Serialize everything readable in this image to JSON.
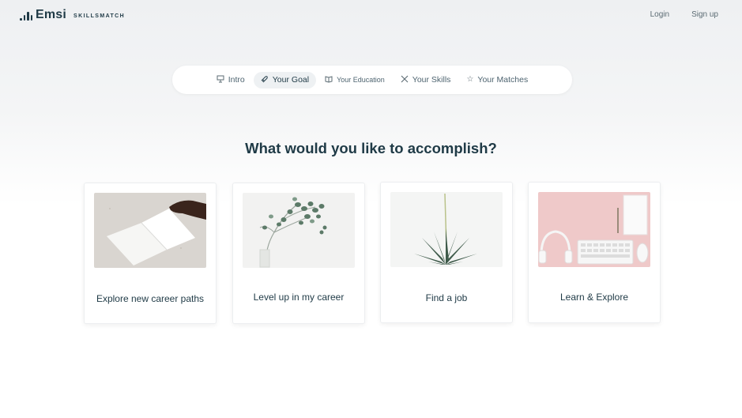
{
  "brand": {
    "name": "Emsi",
    "product": "SKILLSMATCH"
  },
  "nav": {
    "login": "Login",
    "signup": "Sign up"
  },
  "steps": [
    {
      "label": "Intro",
      "icon": "presentation-board-icon"
    },
    {
      "label": "Your Goal",
      "icon": "rocket-icon",
      "active": true
    },
    {
      "label": "Your Education",
      "icon": "book-icon"
    },
    {
      "label": "Your Skills",
      "icon": "tools-icon"
    },
    {
      "label": "Your Matches",
      "icon": "star-icon"
    }
  ],
  "heading": "What would you like to accomplish?",
  "cards": [
    {
      "label": "Explore new career paths",
      "image": "open-notebook"
    },
    {
      "label": "Level up in my career",
      "image": "eucalyptus-branch"
    },
    {
      "label": "Find a job",
      "image": "succulent-plant"
    },
    {
      "label": "Learn & Explore",
      "image": "desk-with-headphones-keyboard"
    }
  ],
  "colors": {
    "primary_text": "#1f3a46",
    "active_step_bg": "#eef1f3",
    "card_border": "#eceef0"
  }
}
